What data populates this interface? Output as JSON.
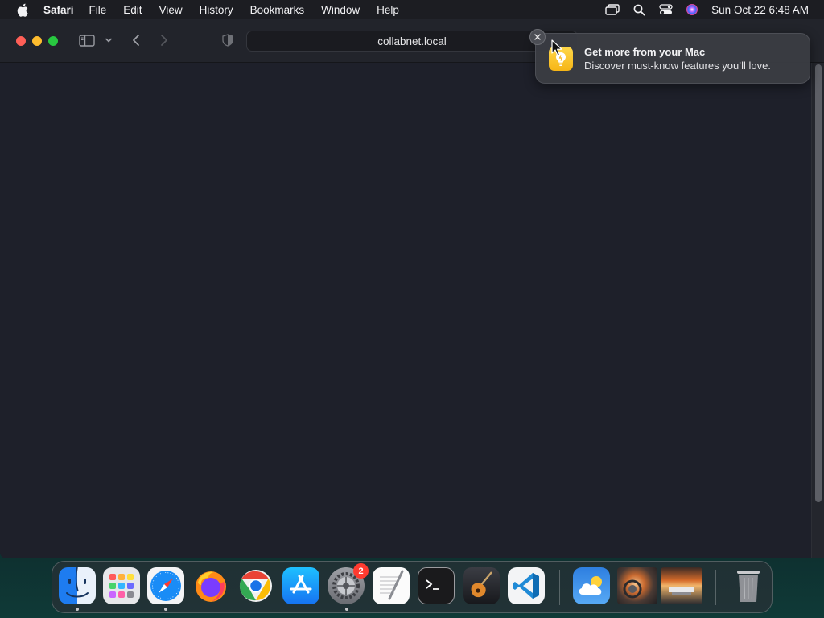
{
  "menubar": {
    "apple_icon": "apple-logo-icon",
    "app_name": "Safari",
    "items": [
      "File",
      "Edit",
      "View",
      "History",
      "Bookmarks",
      "Window",
      "Help"
    ],
    "status_icons": [
      "screen-mirroring-icon",
      "spotlight-search-icon",
      "control-center-icon",
      "siri-icon"
    ],
    "clock": "Sun Oct 22  6:48 AM"
  },
  "browser": {
    "address": "collabnet.local",
    "toolbar_icons": [
      "sidebar-icon",
      "chevron-down-icon",
      "back-icon",
      "forward-icon",
      "privacy-shield-icon"
    ]
  },
  "notification": {
    "title": "Get more from your Mac",
    "body": "Discover must-know features you’ll love.",
    "icon": "tips-lightbulb-icon",
    "close_icon": "close-icon"
  },
  "dock": {
    "apps": [
      "Finder",
      "Launchpad",
      "Safari",
      "Firefox",
      "Google Chrome",
      "App Store",
      "System Settings",
      "TextEdit",
      "Terminal",
      "GarageBand",
      "Visual Studio Code",
      "Weather",
      "Photo Thumbnail 1",
      "Photo Thumbnail 2",
      "Trash"
    ],
    "system_settings_badge": "2"
  },
  "colors": {
    "accent_red": "#ff5f57",
    "accent_yellow": "#febc2e",
    "accent_green": "#28c840",
    "badge_red": "#ff3b30"
  }
}
